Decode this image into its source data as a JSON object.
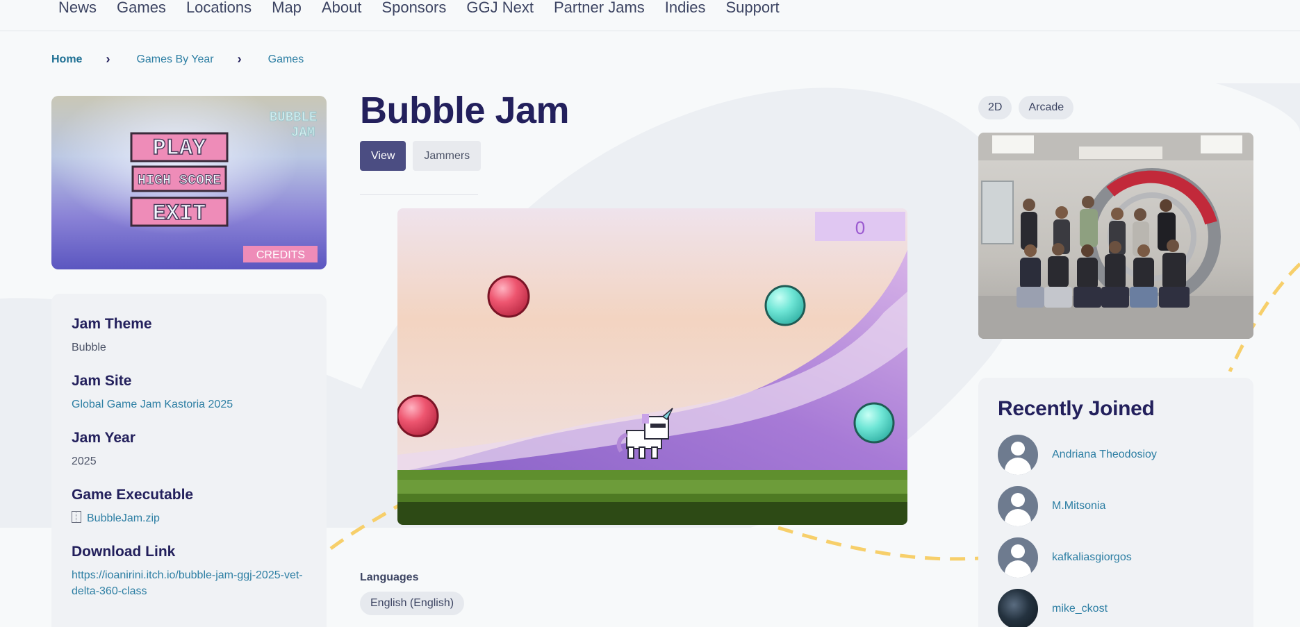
{
  "nav": {
    "items": [
      "News",
      "Games",
      "Locations",
      "Map",
      "About",
      "Sponsors",
      "GGJ Next",
      "Partner Jams",
      "Indies",
      "Support"
    ]
  },
  "breadcrumb": {
    "home": "Home",
    "games_by_year": "Games By Year",
    "games": "Games",
    "separator": "›"
  },
  "thumbnail": {
    "logo_line1": "BUBBLE",
    "logo_line2": "JAM",
    "play": "PLAY",
    "high_score": "HIGH SCORE",
    "exit": "EXIT",
    "credits": "CREDITS"
  },
  "info": {
    "theme_label": "Jam Theme",
    "theme_value": "Bubble",
    "site_label": "Jam Site",
    "site_value": "Global Game Jam Kastoria 2025",
    "year_label": "Jam Year",
    "year_value": "2025",
    "exe_label": "Game Executable",
    "exe_value": "BubbleJam.zip",
    "download_label": "Download Link",
    "download_value": "https://ioanirini.itch.io/bubble-jam-ggj-2025-vet-delta-360-class"
  },
  "game": {
    "title": "Bubble Jam",
    "tab_view": "View",
    "tab_jammers": "Jammers",
    "score": "0",
    "languages_label": "Languages",
    "language": "English (English)"
  },
  "tags": [
    "2D",
    "Arcade"
  ],
  "recent": {
    "title": "Recently Joined",
    "members": [
      "Andriana Theodosioy",
      "M.Mitsonia",
      "kafkaliasgiorgos",
      "mike_ckost"
    ]
  },
  "colors": {
    "primary_text": "#23205c",
    "link": "#2c7ea3",
    "active_tab": "#4b4d82",
    "card_bg": "#f0f2f5",
    "deco_dash": "#f7cf6a"
  }
}
